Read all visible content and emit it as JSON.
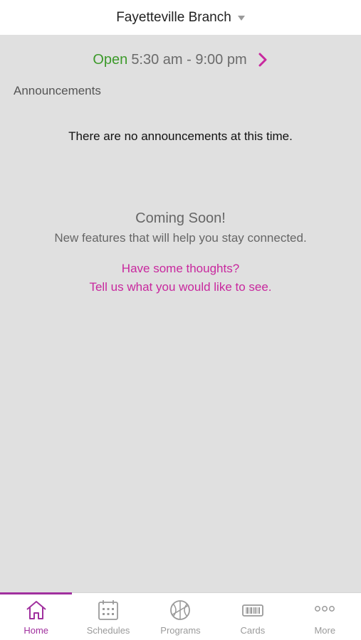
{
  "header": {
    "branch_name": "Fayetteville Branch"
  },
  "hours": {
    "status": "Open",
    "time_range": "5:30 am - 9:00 pm"
  },
  "announcements": {
    "title": "Announcements",
    "empty_message": "There are no announcements at this time."
  },
  "coming_soon": {
    "title": "Coming Soon!",
    "subtitle": "New features that will help you stay connected.",
    "feedback_line1": "Have some thoughts?",
    "feedback_line2": "Tell us what you would like to see."
  },
  "tabs": [
    {
      "label": "Home",
      "icon": "home-icon",
      "active": true
    },
    {
      "label": "Schedules",
      "icon": "calendar-icon",
      "active": false
    },
    {
      "label": "Programs",
      "icon": "basketball-icon",
      "active": false
    },
    {
      "label": "Cards",
      "icon": "card-icon",
      "active": false
    },
    {
      "label": "More",
      "icon": "more-icon",
      "active": false
    }
  ],
  "colors": {
    "accent": "#a0309e",
    "link": "#c8289e",
    "open_green": "#3d9a2b",
    "background": "#e0e0e0"
  }
}
